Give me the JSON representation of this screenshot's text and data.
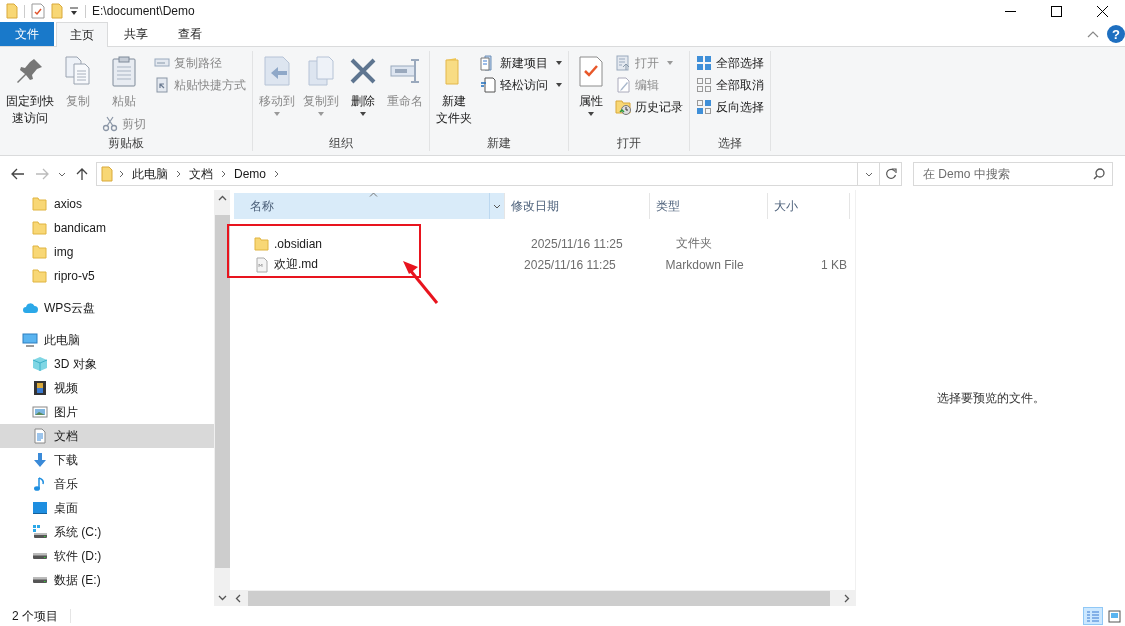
{
  "title_bar": {
    "title": "E:\\document\\Demo"
  },
  "ribbon": {
    "tabs": [
      {
        "label": "文件",
        "kind": "file",
        "selected": false
      },
      {
        "label": "主页",
        "kind": "tab",
        "selected": true
      },
      {
        "label": "共享",
        "kind": "tab",
        "selected": false
      },
      {
        "label": "查看",
        "kind": "tab",
        "selected": false
      }
    ],
    "help_button": "?",
    "groups": [
      {
        "label": "剪贴板",
        "items": [
          {
            "kind": "large",
            "label_lines": [
              "固定到快",
              "速访问"
            ],
            "disabled": false,
            "dropdown": false
          },
          {
            "kind": "large",
            "label": "复制",
            "disabled": true,
            "dropdown": false
          },
          {
            "kind": "large",
            "label": "粘贴",
            "disabled": true,
            "dropdown": false,
            "below": {
              "label": "剪切",
              "disabled": true
            }
          },
          {
            "kind": "stack",
            "items": [
              {
                "label": "复制路径",
                "disabled": true,
                "dropdown": false
              },
              {
                "label": "粘贴快捷方式",
                "disabled": true,
                "dropdown": false
              }
            ]
          }
        ]
      },
      {
        "label": "组织",
        "items": [
          {
            "kind": "large",
            "label": "移动到",
            "disabled": true,
            "dropdown": true
          },
          {
            "kind": "large",
            "label": "复制到",
            "disabled": true,
            "dropdown": true
          },
          {
            "kind": "large",
            "label": "删除",
            "disabled": false,
            "dropdown": true
          },
          {
            "kind": "large",
            "label": "重命名",
            "disabled": true,
            "dropdown": false
          }
        ]
      },
      {
        "label": "新建",
        "items": [
          {
            "kind": "large",
            "label_lines": [
              "新建",
              "文件夹"
            ],
            "disabled": false,
            "dropdown": false
          },
          {
            "kind": "stack",
            "items": [
              {
                "label": "新建项目",
                "disabled": false,
                "dropdown": true
              },
              {
                "label": "轻松访问",
                "disabled": false,
                "dropdown": true
              }
            ]
          }
        ]
      },
      {
        "label": "打开",
        "items": [
          {
            "kind": "large",
            "label": "属性",
            "disabled": false,
            "dropdown": true
          },
          {
            "kind": "stack",
            "items": [
              {
                "label": "打开",
                "disabled": true,
                "dropdown": true
              },
              {
                "label": "编辑",
                "disabled": true,
                "dropdown": false
              },
              {
                "label": "历史记录",
                "disabled": false,
                "dropdown": false
              }
            ]
          }
        ]
      },
      {
        "label": "选择",
        "items": [
          {
            "kind": "stack",
            "items": [
              {
                "label": "全部选择",
                "disabled": false,
                "dropdown": false
              },
              {
                "label": "全部取消",
                "disabled": false,
                "dropdown": false
              },
              {
                "label": "反向选择",
                "disabled": false,
                "dropdown": false
              }
            ]
          }
        ]
      }
    ]
  },
  "address_bar": {
    "back_disabled": false,
    "forward_disabled": true,
    "breadcrumbs": [
      "此电脑",
      "文档",
      "Demo"
    ]
  },
  "search": {
    "placeholder": "在 Demo 中搜索"
  },
  "sidebar": {
    "scrolled_children": [
      {
        "label": "axios",
        "kind": "folder",
        "selected": false
      },
      {
        "label": "bandicam",
        "kind": "folder",
        "selected": false
      },
      {
        "label": "img",
        "kind": "folder",
        "selected": false
      },
      {
        "label": "ripro-v5",
        "kind": "folder",
        "selected": false
      }
    ],
    "items": [
      {
        "label": "WPS云盘",
        "kind": "cloud",
        "selected": false
      },
      {
        "label": "此电脑",
        "kind": "pc",
        "selected": false,
        "children": [
          {
            "label": "3D 对象",
            "kind": "objects3d",
            "selected": false
          },
          {
            "label": "视频",
            "kind": "video",
            "selected": false
          },
          {
            "label": "图片",
            "kind": "pictures",
            "selected": false
          },
          {
            "label": "文档",
            "kind": "documents",
            "selected": true
          },
          {
            "label": "下载",
            "kind": "downloads",
            "selected": false
          },
          {
            "label": "音乐",
            "kind": "music",
            "selected": false
          },
          {
            "label": "桌面",
            "kind": "desktop",
            "selected": false
          },
          {
            "label": "系统 (C:)",
            "kind": "system_drive",
            "selected": false
          },
          {
            "label": "软件 (D:)",
            "kind": "drive",
            "selected": false
          },
          {
            "label": "数据 (E:)",
            "kind": "drive",
            "selected": false
          }
        ]
      }
    ]
  },
  "file_list": {
    "columns": [
      {
        "label": "名称",
        "sorted": true,
        "highlighted": true
      },
      {
        "label": "修改日期",
        "sorted": false,
        "highlighted": false
      },
      {
        "label": "类型",
        "sorted": false,
        "highlighted": false
      },
      {
        "label": "大小",
        "sorted": false,
        "highlighted": false
      }
    ],
    "rows": [
      {
        "kind": "folder",
        "name": ".obsidian",
        "modified": "2025/11/16 11:25",
        "type": "文件夹"
      },
      {
        "kind": "markdown",
        "name": "欢迎.md",
        "modified": "2025/11/16 11:25",
        "type": "Markdown File",
        "size": "1 KB"
      }
    ]
  },
  "preview": {
    "message": "选择要预览的文件。"
  },
  "status_bar": {
    "item_count": "2 个项目",
    "views": [
      {
        "kind": "details",
        "selected": true
      },
      {
        "kind": "large_icons",
        "selected": false
      }
    ]
  }
}
